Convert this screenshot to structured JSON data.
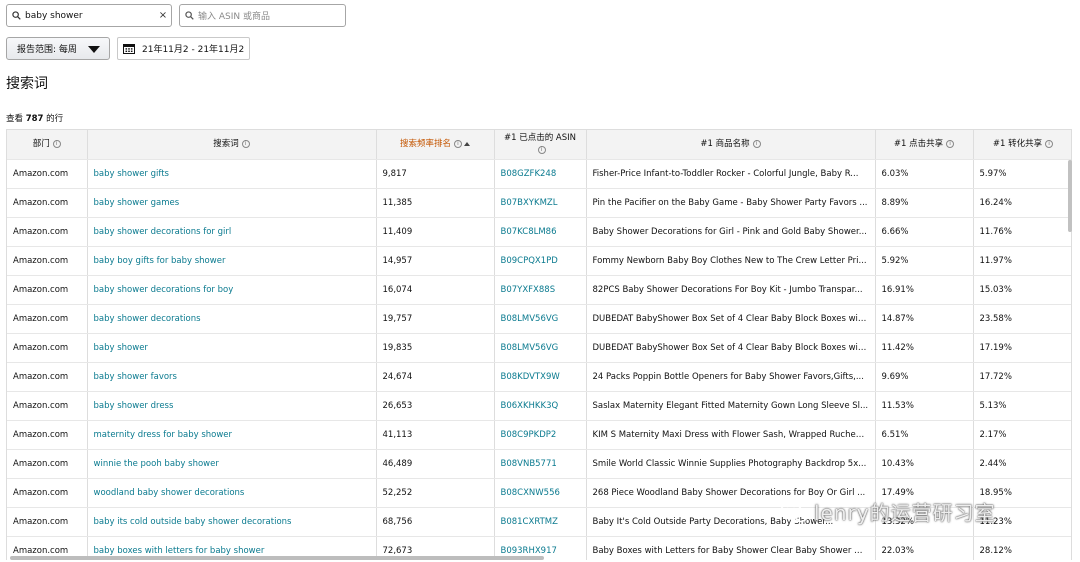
{
  "search": {
    "value": "baby shower",
    "clear_glyph": "×",
    "icon": "search-icon"
  },
  "asin_search": {
    "placeholder": "输入 ASIN 或商品",
    "icon": "search-icon"
  },
  "report_range": {
    "label": "报告范围: 每周"
  },
  "date_range": {
    "value": "21年11月2 - 21年11月2",
    "icon": "calendar-icon"
  },
  "section_title": "搜索词",
  "row_count": {
    "prefix": "查看",
    "count": "787",
    "suffix": "的行"
  },
  "table": {
    "columns": [
      {
        "label": "部门",
        "info": true
      },
      {
        "label": "搜索词",
        "info": true
      },
      {
        "label": "搜索频率排名",
        "info": true,
        "sorted": true
      },
      {
        "label": "#1 已点击的 ASIN",
        "info": true
      },
      {
        "label": "#1 商品名称",
        "info": true
      },
      {
        "label": "#1 点击共享",
        "info": true
      },
      {
        "label": "#1 转化共享",
        "info": true
      }
    ],
    "rows": [
      [
        "Amazon.com",
        "baby shower gifts",
        "9,817",
        "B08GZFK248",
        "Fisher-Price Infant-to-Toddler Rocker - Colorful Jungle, Baby R...",
        "6.03%",
        "5.97%"
      ],
      [
        "Amazon.com",
        "baby shower games",
        "11,385",
        "B07BXYKMZL",
        "Pin the Pacifier on the Baby Game - Baby Shower Party Favors ...",
        "8.89%",
        "16.24%"
      ],
      [
        "Amazon.com",
        "baby shower decorations for girl",
        "11,409",
        "B07KC8LM86",
        "Baby Shower Decorations for Girl - Pink and Gold Baby Shower...",
        "6.66%",
        "11.76%"
      ],
      [
        "Amazon.com",
        "baby boy gifts for baby shower",
        "14,957",
        "B09CPQX1PD",
        "Fommy Newborn Baby Boy Clothes New to The Crew Letter Pri...",
        "5.92%",
        "11.97%"
      ],
      [
        "Amazon.com",
        "baby shower decorations for boy",
        "16,074",
        "B07YXFX88S",
        "82PCS Baby Shower Decorations For Boy Kit - Jumbo Transpar...",
        "16.91%",
        "15.03%"
      ],
      [
        "Amazon.com",
        "baby shower decorations",
        "19,757",
        "B08LMV56VG",
        "DUBEDAT BabyShower Box Set of 4 Clear Baby Block Boxes wit...",
        "14.87%",
        "23.58%"
      ],
      [
        "Amazon.com",
        "baby shower",
        "19,835",
        "B08LMV56VG",
        "DUBEDAT BabyShower Box Set of 4 Clear Baby Block Boxes wit...",
        "11.42%",
        "17.19%"
      ],
      [
        "Amazon.com",
        "baby shower favors",
        "24,674",
        "B08KDVTX9W",
        "24 Packs Poppin Bottle Openers for Baby Shower Favors,Gifts,...",
        "9.69%",
        "17.72%"
      ],
      [
        "Amazon.com",
        "baby shower dress",
        "26,653",
        "B06XKHKK3Q",
        "Saslax Maternity Elegant Fitted Maternity Gown Long Sleeve Sl...",
        "11.53%",
        "5.13%"
      ],
      [
        "Amazon.com",
        "maternity dress for baby shower",
        "41,113",
        "B08C9PKDP2",
        "KIM S Maternity Maxi Dress with Flower Sash, Wrapped Ruched...",
        "6.51%",
        "2.17%"
      ],
      [
        "Amazon.com",
        "winnie the pooh baby shower",
        "46,489",
        "B08VNB5771",
        "Smile World Classic Winnie Supplies Photography Backdrop 5x...",
        "10.43%",
        "2.44%"
      ],
      [
        "Amazon.com",
        "woodland baby shower decorations",
        "52,252",
        "B08CXNW556",
        "268 Piece Woodland Baby Shower Decorations for Boy Or Girl ...",
        "17.49%",
        "18.95%"
      ],
      [
        "Amazon.com",
        "baby its cold outside baby shower decorations",
        "68,756",
        "B081CXRTMZ",
        "Baby It's Cold Outside Party Decorations, Baby Shower...",
        "13.32%",
        "11.23%"
      ],
      [
        "Amazon.com",
        "baby boxes with letters for baby shower",
        "72,673",
        "B093RHX917",
        "Baby Boxes with Letters for Baby Shower Clear Baby Shower D...",
        "22.03%",
        "28.12%"
      ]
    ]
  },
  "watermark": "lenry的运营研习室"
}
